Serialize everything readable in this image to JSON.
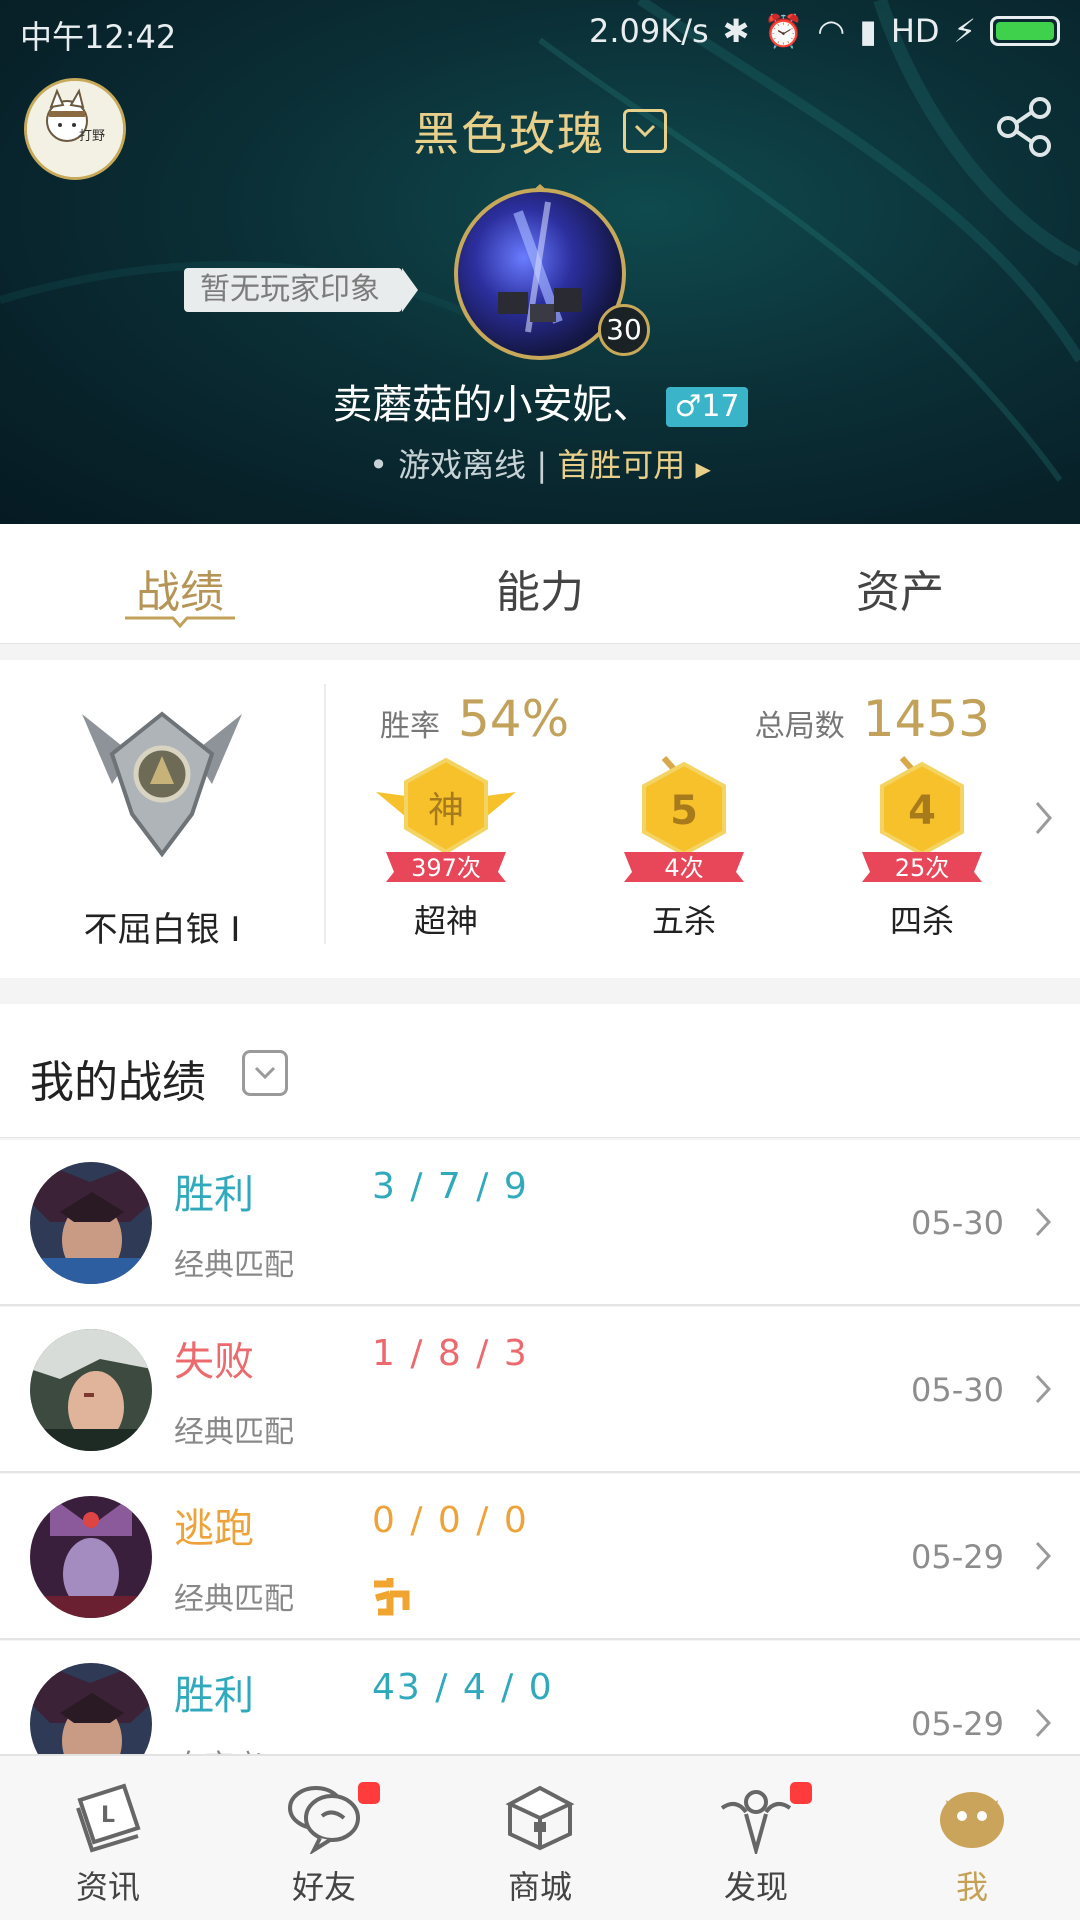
{
  "status_bar": {
    "time": "中午12:42",
    "net_speed": "2.09K/s",
    "network": "HD"
  },
  "header": {
    "server_title": "黑色玫瑰",
    "impression_tag": "暂无玩家印象",
    "level": "30",
    "nickname": "卖蘑菇的小安妮、",
    "gender_age": "♂17",
    "online_status": "• 游戏离线 |",
    "first_win": "首胜可用",
    "avatar_text": "打野"
  },
  "tabs": [
    {
      "label": "战绩",
      "active": true
    },
    {
      "label": "能力",
      "active": false
    },
    {
      "label": "资产",
      "active": false
    }
  ],
  "stats": {
    "rank_name": "不屈白银 I",
    "winrate_label": "胜率",
    "winrate_value": "54%",
    "total_label": "总局数",
    "total_value": "1453",
    "medals": [
      {
        "glyph": "神",
        "count": "397次",
        "name": "超神"
      },
      {
        "glyph": "5",
        "count": "4次",
        "name": "五杀"
      },
      {
        "glyph": "4",
        "count": "25次",
        "name": "四杀"
      }
    ]
  },
  "records": {
    "title": "我的战绩",
    "rows": [
      {
        "result": "胜利",
        "kda": "3 / 7 / 9",
        "mode": "经典匹配",
        "date": "05-30",
        "type": "win"
      },
      {
        "result": "失败",
        "kda": "1 / 8 / 3",
        "mode": "经典匹配",
        "date": "05-30",
        "type": "lose"
      },
      {
        "result": "逃跑",
        "kda": "0 / 0 / 0",
        "mode": "经典匹配",
        "date": "05-29",
        "type": "flee"
      },
      {
        "result": "胜利",
        "kda": "43 / 4 / 0",
        "mode": "自定义",
        "date": "05-29",
        "type": "win"
      }
    ]
  },
  "bottom_nav": [
    {
      "label": "资讯",
      "icon": "news-icon",
      "badge": false,
      "active": false
    },
    {
      "label": "好友",
      "icon": "chat-icon",
      "badge": true,
      "active": false
    },
    {
      "label": "商城",
      "icon": "chest-icon",
      "badge": false,
      "active": false
    },
    {
      "label": "发现",
      "icon": "angel-icon",
      "badge": true,
      "active": false
    },
    {
      "label": "我",
      "icon": "poro-icon",
      "badge": false,
      "active": true
    }
  ],
  "colors": {
    "gold": "#c2a25a",
    "win": "#30a9bd",
    "lose": "#ec6a6e",
    "flee": "#eea33a"
  }
}
